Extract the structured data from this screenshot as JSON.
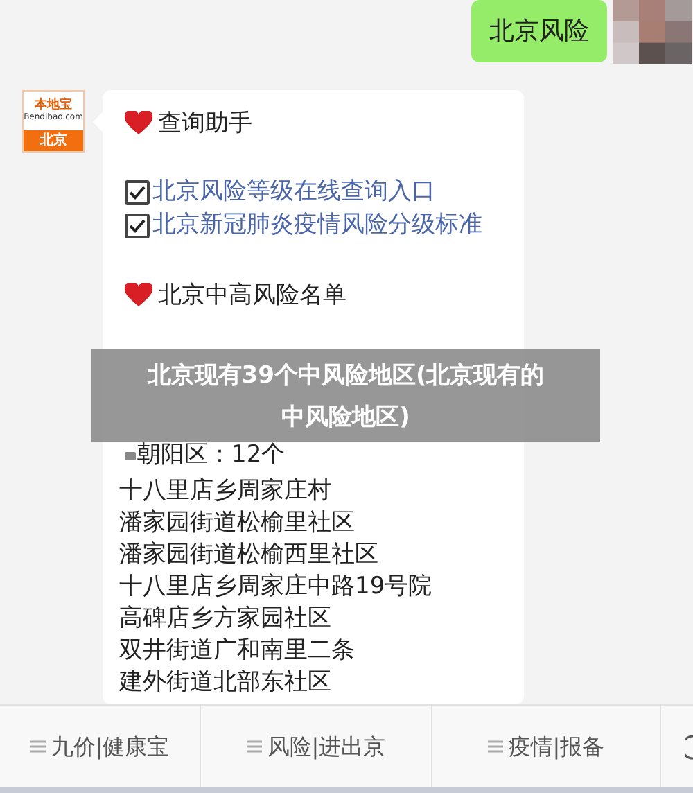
{
  "sent_message": {
    "text": "北京风险"
  },
  "bot": {
    "logo_name": "本地宝",
    "logo_site": "Bendibao.com",
    "logo_city": "北京"
  },
  "reply": {
    "heading": "查询助手",
    "links": [
      {
        "text": "北京风险等级在线查询入口",
        "checked": true
      },
      {
        "text": "北京新冠肺炎疫情风险分级标准",
        "checked": true
      }
    ],
    "list_heading": "北京中高风险名单",
    "district": "朝阳区：12个",
    "places": [
      "十八里店乡周家庄村",
      "潘家园街道松榆里社区",
      "潘家园街道松榆西里社区",
      "十八里店乡周家庄中路19号院",
      "高碑店乡方家园社区",
      "双井街道广和南里二条",
      "建外街道北部东社区"
    ]
  },
  "caption_banner": "北京现有39个中风险地区(北京现有的中风险地区)",
  "menu_bar": [
    {
      "label": "九价|健康宝"
    },
    {
      "label": "风险|进出京"
    },
    {
      "label": "疫情|报备"
    }
  ]
}
